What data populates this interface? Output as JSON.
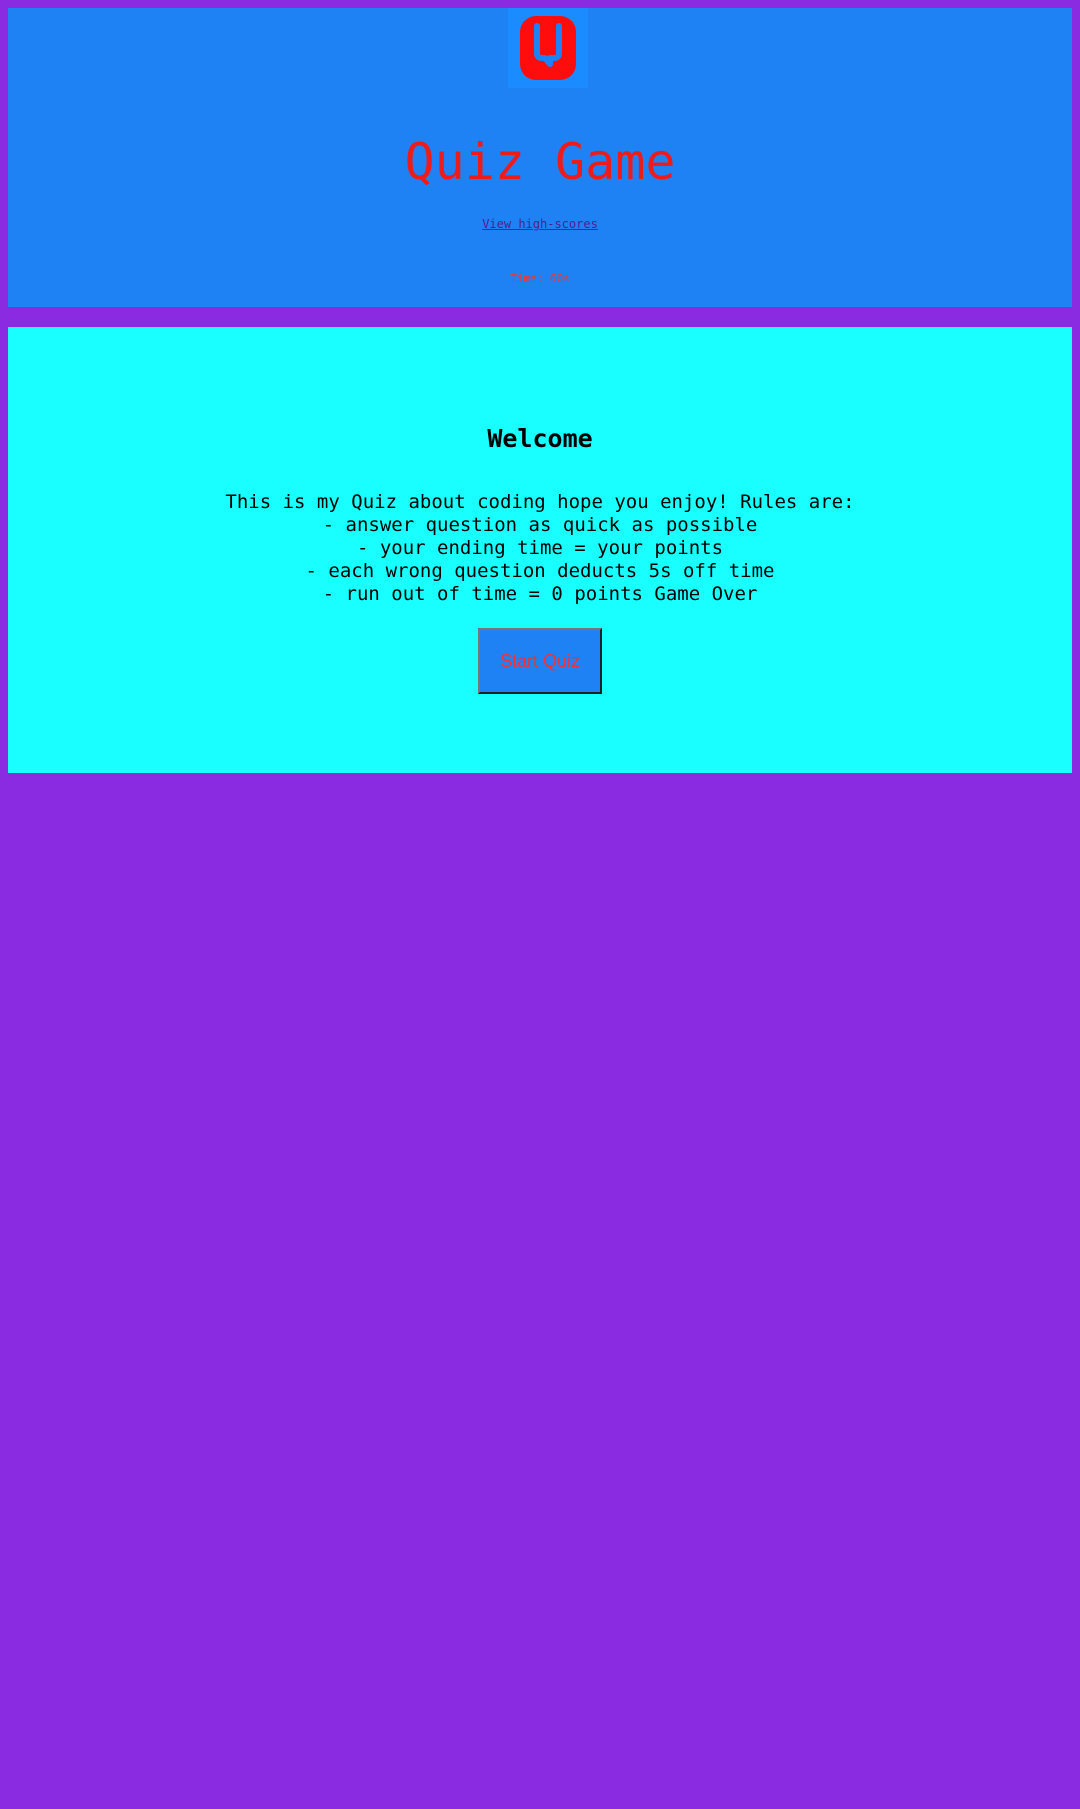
{
  "header": {
    "logo_icon": "quiz-q-icon",
    "title": "Quiz Game",
    "highscores_link": "View high-scores",
    "timer": "Time: 60s"
  },
  "main": {
    "heading": "Welcome",
    "rules": [
      "This is my Quiz about coding hope you enjoy! Rules are:",
      "- answer question as quick as possible",
      "- your ending time = your points",
      "- each wrong question deducts 5s off time",
      "- run out of time = 0 points Game Over"
    ],
    "start_button": "Start Quiz"
  },
  "colors": {
    "page_background": "#8a2be2",
    "header_background": "#1e82f5",
    "main_background": "#19ffff",
    "accent_red": "#ee1b1b",
    "link": "#551a8b"
  }
}
